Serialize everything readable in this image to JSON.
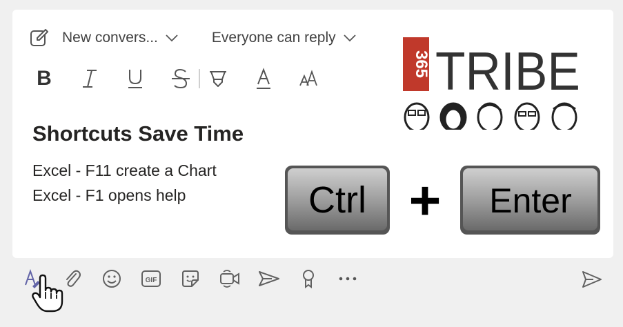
{
  "compose": {
    "conversation_dropdown": "New convers...",
    "reply_dropdown": "Everyone can reply",
    "format_toolbar": {
      "bold": "B",
      "italic": "I",
      "underline": "U",
      "strike": "S",
      "font_color": "A",
      "font_size": "AA"
    },
    "title": "Shortcuts Save Time",
    "lines": [
      "Excel - F11 create a Chart",
      "Excel - F1 opens help"
    ]
  },
  "logo": {
    "digits": "365",
    "word": "TRIBE"
  },
  "shortcut_keys": {
    "key1": "Ctrl",
    "plus": "+",
    "key2": "Enter"
  },
  "bottom_toolbar": {
    "gif_label": "GIF",
    "icons": [
      "format-icon",
      "attach-icon",
      "emoji-icon",
      "gif-icon",
      "sticker-icon",
      "meet-now-icon",
      "stream-icon",
      "praise-icon",
      "more-icon",
      "send-icon"
    ]
  },
  "colors": {
    "accent": "#6264a7",
    "text": "#252423",
    "icon": "#616161"
  }
}
